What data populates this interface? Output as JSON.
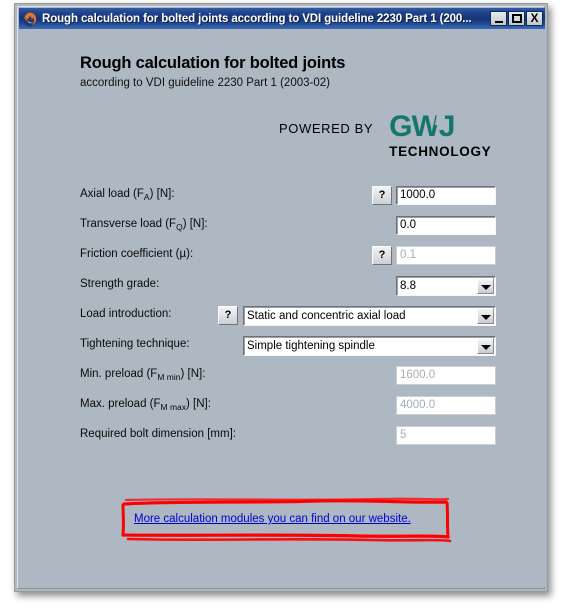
{
  "window": {
    "title": "Rough calculation for bolted joints according to VDI guideline 2230 Part 1 (200...",
    "app_icon": "firefox-icon",
    "minimize_label": "",
    "maximize_label": "",
    "close_label": "X"
  },
  "header": {
    "title": "Rough calculation for bolted joints",
    "subtitle": "according to VDI guideline 2230 Part 1 (2003-02)",
    "powered_by": "POWERED BY",
    "brand_mark": "GWJ",
    "brand_sub": "TECHNOLOGY",
    "brand_color": "#15776b"
  },
  "form": {
    "help_glyph": "?",
    "rows": [
      {
        "name": "axial-load",
        "label_main": "Axial load (F",
        "label_sub": "A",
        "label_tail": ") [N]:",
        "has_help": true,
        "type": "text",
        "value": "1000.0",
        "enabled": true
      },
      {
        "name": "transverse-load",
        "label_main": "Transverse load (F",
        "label_sub": "Q",
        "label_tail": ") [N]:",
        "has_help": false,
        "type": "text",
        "value": "0.0",
        "enabled": true
      },
      {
        "name": "friction-coefficient",
        "label_main": "Friction coefficient (µ",
        "label_sub": "",
        "label_tail": "):",
        "has_help": true,
        "type": "text",
        "value": "0.1",
        "enabled": false
      },
      {
        "name": "strength-grade",
        "label_main": "Strength grade:",
        "label_sub": "",
        "label_tail": "",
        "has_help": false,
        "type": "combo",
        "value": "8.8",
        "enabled": true
      },
      {
        "name": "load-introduction",
        "label_main": "Load introduction:",
        "label_sub": "",
        "label_tail": "",
        "has_help": true,
        "type": "combo",
        "value": "Static and concentric axial load",
        "enabled": true
      },
      {
        "name": "tightening-technique",
        "label_main": "Tightening technique:",
        "label_sub": "",
        "label_tail": "",
        "has_help": false,
        "type": "combo",
        "value": "Simple tightening spindle",
        "enabled": true
      },
      {
        "name": "min-preload",
        "label_main": "Min. preload (F",
        "label_sub": "M min",
        "label_tail": ") [N]:",
        "has_help": false,
        "type": "text",
        "value": "1600.0",
        "enabled": false
      },
      {
        "name": "max-preload",
        "label_main": "Max. preload (F",
        "label_sub": "M max",
        "label_tail": ") [N]:",
        "has_help": false,
        "type": "text",
        "value": "4000.0",
        "enabled": false
      },
      {
        "name": "required-bolt-dimension",
        "label_main": "Required bolt dimension [mm]:",
        "label_sub": "",
        "label_tail": "",
        "has_help": false,
        "type": "text",
        "value": "5",
        "enabled": false
      }
    ]
  },
  "footer": {
    "link_text": "More calculation modules you can find on our website.",
    "link_color": "#0000d4",
    "annotation_color": "#ff0000"
  }
}
